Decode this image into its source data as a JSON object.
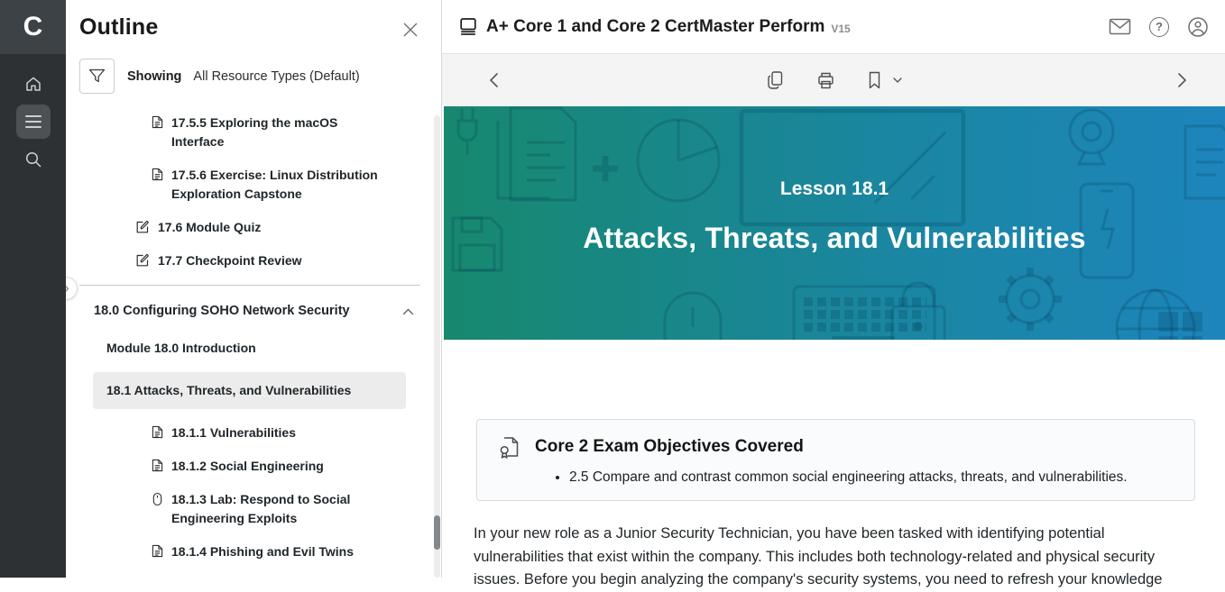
{
  "rail": {
    "logo": "C"
  },
  "outline": {
    "title": "Outline",
    "showing_label": "Showing",
    "showing_value": "All Resource Types (Default)",
    "items": [
      {
        "label": "17.5.5 Exploring the macOS Interface",
        "icon": "document"
      },
      {
        "label": "17.5.6 Exercise: Linux Distribution Exploration Capstone",
        "icon": "document"
      },
      {
        "label": "17.6 Module Quiz",
        "icon": "quiz"
      },
      {
        "label": "17.7 Checkpoint Review",
        "icon": "quiz"
      },
      {
        "label": "18.0 Configuring SOHO Network Security",
        "icon": "section-collapse"
      },
      {
        "label": "Module 18.0 Introduction",
        "icon": "none"
      },
      {
        "label": "18.1 Attacks, Threats, and Vulnerabilities",
        "icon": "none",
        "selected": true
      },
      {
        "label": "18.1.1 Vulnerabilities",
        "icon": "document"
      },
      {
        "label": "18.1.2 Social Engineering",
        "icon": "document"
      },
      {
        "label": "18.1.3 Lab: Respond to Social Engineering Exploits",
        "icon": "lab-mouse"
      },
      {
        "label": "18.1.4 Phishing and Evil Twins",
        "icon": "document"
      }
    ]
  },
  "header": {
    "title": "A+ Core 1 and Core 2 CertMaster Perform",
    "version": "V15"
  },
  "banner": {
    "kicker": "Lesson 18.1",
    "title": "Attacks, Threats, and Vulnerabilities",
    "gradient_from": "#17886E",
    "gradient_to": "#1D85BC"
  },
  "objectives": {
    "title": "Core 2 Exam Objectives Covered",
    "bullets": [
      "2.5 Compare and contrast common social engineering attacks, threats, and vulnerabilities."
    ]
  },
  "body_text": {
    "paragraph": "In your new role as a Junior Security Technician, you have been tasked with identifying potential vulnerabilities that exist within the company. This includes both technology-related and physical security issues. Before you begin analyzing the company's security systems, you need to refresh your knowledge"
  }
}
